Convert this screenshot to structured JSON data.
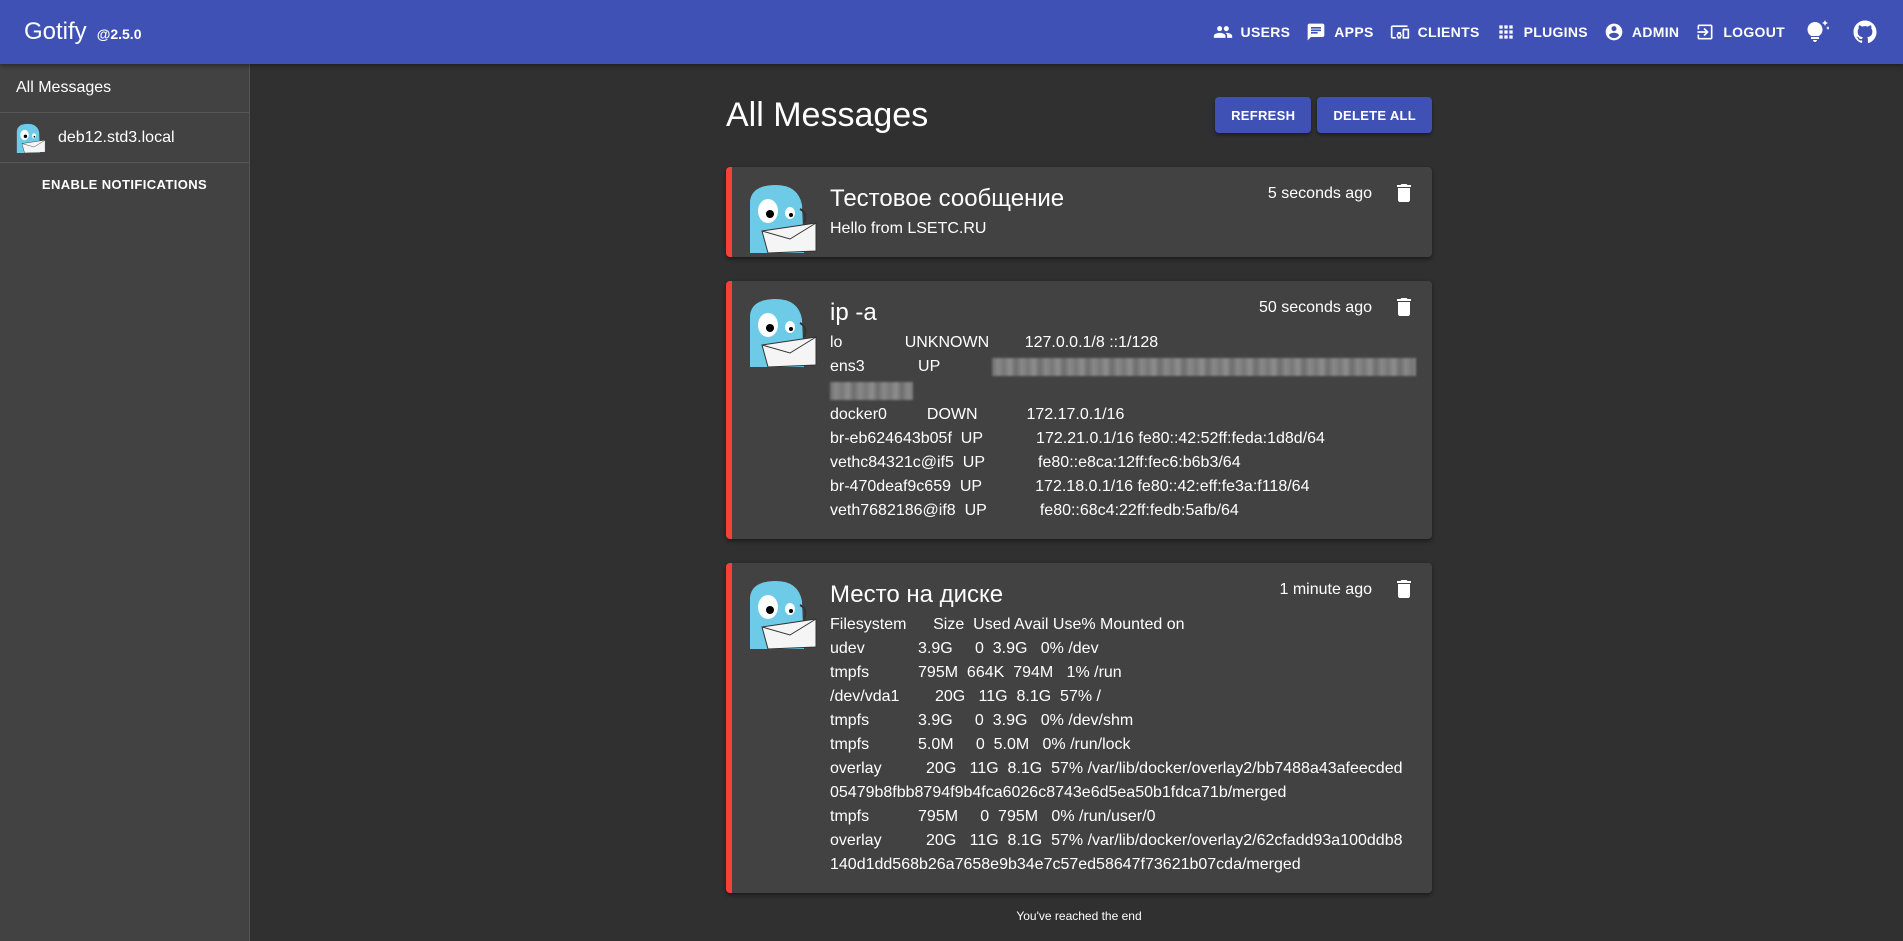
{
  "appbar": {
    "title": "Gotify",
    "version": "@2.5.0",
    "nav": [
      {
        "label": "USERS",
        "icon": "users-icon"
      },
      {
        "label": "APPS",
        "icon": "chat-icon"
      },
      {
        "label": "CLIENTS",
        "icon": "devices-icon"
      },
      {
        "label": "PLUGINS",
        "icon": "apps-grid-icon"
      },
      {
        "label": "ADMIN",
        "icon": "account-circle-icon"
      },
      {
        "label": "LOGOUT",
        "icon": "exit-icon"
      }
    ],
    "theme_icon": "lightbulb-icon",
    "github_icon": "github-icon"
  },
  "sidebar": {
    "all_messages": "All Messages",
    "apps": [
      {
        "label": "deb12.std3.local"
      }
    ],
    "enable_notifications": "ENABLE NOTIFICATIONS"
  },
  "main": {
    "title": "All Messages",
    "refresh_label": "REFRESH",
    "delete_all_label": "DELETE ALL",
    "end_text": "You've reached the end"
  },
  "messages": [
    {
      "title": "Тестовое сообщение",
      "time": "5 seconds ago",
      "body_lines": [
        "Hello from LSETC.RU"
      ]
    },
    {
      "title": "ip -a",
      "time": "50 seconds ago",
      "body_lines": [
        "lo              UNKNOWN        127.0.0.1/8 ::1/128",
        "ens3            UP",
        "",
        "docker0         DOWN           172.17.0.1/16",
        "br-eb624643b05f  UP            172.21.0.1/16 fe80::42:52ff:feda:1d8d/64",
        "vethc84321c@if5  UP            fe80::e8ca:12ff:fec6:b6b3/64",
        "br-470deaf9c659  UP            172.18.0.1/16 fe80::42:eff:fe3a:f118/64",
        "veth7682186@if8  UP            fe80::68c4:22ff:fedb:5afb/64"
      ]
    },
    {
      "title": "Место на диске",
      "time": "1 minute ago",
      "body_lines": [
        "Filesystem      Size  Used Avail Use% Mounted on",
        "udev            3.9G     0  3.9G   0% /dev",
        "tmpfs           795M  664K  794M   1% /run",
        "/dev/vda1        20G   11G  8.1G  57% /",
        "tmpfs           3.9G     0  3.9G   0% /dev/shm",
        "tmpfs           5.0M     0  5.0M   0% /run/lock",
        "overlay          20G   11G  8.1G  57% /var/lib/docker/overlay2/bb7488a43afeecded",
        "05479b8fbb8794f9b4fca6026c8743e6d5ea50b1fdca71b/merged",
        "tmpfs           795M     0  795M   0% /run/user/0",
        "overlay          20G   11G  8.1G  57% /var/lib/docker/overlay2/62cfadd93a100ddb8",
        "140d1dd568b26a7658e9b34e7c57ed58647f73621b07cda/merged"
      ]
    }
  ],
  "colors": {
    "appbar": "#3f51b5",
    "background": "#303030",
    "card": "#424242",
    "accent_border": "#f44336"
  }
}
